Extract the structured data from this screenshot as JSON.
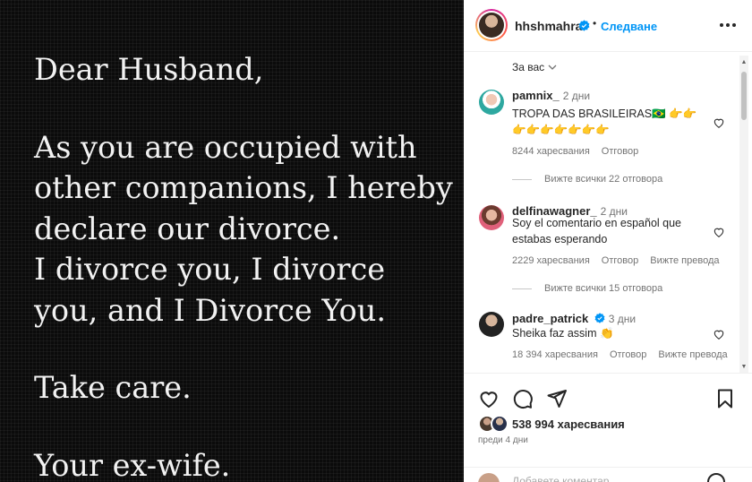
{
  "post": {
    "letter_lines": [
      [
        "Dear Husband,"
      ],
      [
        "As you are occupied with",
        "other companions, I hereby",
        "declare our divorce.",
        "I divorce you, I divorce",
        "you, and I Divorce You."
      ],
      [
        "Take care."
      ],
      [
        "Your ex-wife."
      ]
    ]
  },
  "header": {
    "username": "hhshmahra",
    "separator": "•",
    "follow_label": "Следване",
    "more_icon": "more-horizontal-icon"
  },
  "comments": {
    "sort_label": "За вас",
    "items": [
      {
        "user": "pamnix_",
        "time": "2 дни",
        "lines": [
          "TROPA DAS BRASILEIRAS🇧🇷 👉👉",
          "👉👉👉👉👉👉👉"
        ],
        "likes": "8244 харесвания",
        "reply": "Отговор",
        "translate": "",
        "replies_link": "Вижте всички 22 отговора"
      },
      {
        "user": "delfinawagner_",
        "time": "2 дни",
        "lines": [
          "Soy el comentario en español que",
          "estabas esperando"
        ],
        "likes": "2229 харесвания",
        "reply": "Отговор",
        "translate": "Вижте превода",
        "replies_link": "Вижте всички 15 отговора"
      },
      {
        "user": "padre_patrick",
        "time": "3 дни",
        "lines": [
          "Sheika faz assim 👏"
        ],
        "likes": "18 394 харесвания",
        "reply": "Отговор",
        "translate": "Вижте превода",
        "replies_link": ""
      }
    ]
  },
  "actions": {
    "likes_count": "538 994 харесвания",
    "posted": "преди 4 дни",
    "add_comment_placeholder": "Добавете коментар..."
  },
  "colors": {
    "accent": "#0095f6",
    "verified": "#0095f6",
    "muted": "#737373",
    "text": "#262626"
  }
}
